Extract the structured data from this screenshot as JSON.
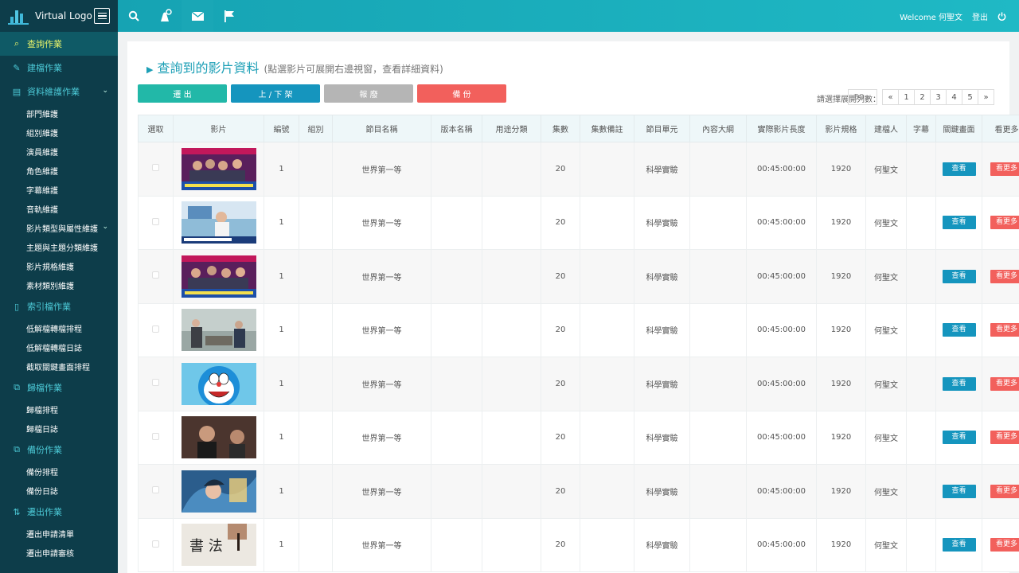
{
  "app": {
    "logo_text": "Virtual Logo"
  },
  "topbar": {
    "welcome": "Welcome 何聖文",
    "logout": "登出"
  },
  "sidebar": {
    "sections": [
      {
        "label": "查詢作業",
        "icon": "search-icon",
        "active": true
      },
      {
        "label": "建檔作業",
        "icon": "edit-icon"
      },
      {
        "label": "資料維護作業",
        "icon": "database-icon",
        "items": [
          "部門維護",
          "組別維護",
          "演員維護",
          "角色維護",
          "字幕維護",
          "音軌維護",
          "影片類型與屬性維護",
          "主題與主題分類維護",
          "影片規格維護",
          "素材類別維護"
        ]
      },
      {
        "label": "索引檔作業",
        "icon": "file-icon",
        "items": [
          "低解檔轉檔排程",
          "低解檔轉檔日誌",
          "截取關鍵畫面排程"
        ]
      },
      {
        "label": "歸檔作業",
        "icon": "archive-icon",
        "items": [
          "歸檔排程",
          "歸檔日誌"
        ]
      },
      {
        "label": "備份作業",
        "icon": "copy-icon",
        "items": [
          "備份排程",
          "備份日誌"
        ]
      },
      {
        "label": "遷出作業",
        "icon": "transfer-icon",
        "items": [
          "遷出申請清單",
          "遷出申請審核"
        ]
      }
    ]
  },
  "page": {
    "title": "查詢到的影片資料",
    "subtitle": "(點選影片可展開右邊視窗，查看詳細資料)",
    "buttons": {
      "out": "遷 出",
      "shelf": "上 / 下 架",
      "scrap": "報 廢",
      "backup": "備 份"
    },
    "pager_label": "請選擇展開列數：",
    "page_size": "50",
    "pages": [
      "«",
      "1",
      "2",
      "3",
      "4",
      "5",
      "»"
    ]
  },
  "table": {
    "headers": [
      "選取",
      "影片",
      "編號",
      "組別",
      "節目名稱",
      "版本名稱",
      "用途分類",
      "集數",
      "集數備註",
      "節目單元",
      "內容大綱",
      "實際影片長度",
      "影片規格",
      "建檔人",
      "字幕",
      "關鍵畫面",
      "看更多"
    ],
    "view_label": "查看",
    "more_label": "看更多",
    "rows": [
      {
        "id": "1",
        "program": "世界第一等",
        "episodes": "20",
        "unit": "科學實驗",
        "duration": "00:45:00:00",
        "spec": "1920",
        "creator": "何聖文"
      },
      {
        "id": "1",
        "program": "世界第一等",
        "episodes": "20",
        "unit": "科學實驗",
        "duration": "00:45:00:00",
        "spec": "1920",
        "creator": "何聖文"
      },
      {
        "id": "1",
        "program": "世界第一等",
        "episodes": "20",
        "unit": "科學實驗",
        "duration": "00:45:00:00",
        "spec": "1920",
        "creator": "何聖文"
      },
      {
        "id": "1",
        "program": "世界第一等",
        "episodes": "20",
        "unit": "科學實驗",
        "duration": "00:45:00:00",
        "spec": "1920",
        "creator": "何聖文"
      },
      {
        "id": "1",
        "program": "世界第一等",
        "episodes": "20",
        "unit": "科學實驗",
        "duration": "00:45:00:00",
        "spec": "1920",
        "creator": "何聖文"
      },
      {
        "id": "1",
        "program": "世界第一等",
        "episodes": "20",
        "unit": "科學實驗",
        "duration": "00:45:00:00",
        "spec": "1920",
        "creator": "何聖文"
      },
      {
        "id": "1",
        "program": "世界第一等",
        "episodes": "20",
        "unit": "科學實驗",
        "duration": "00:45:00:00",
        "spec": "1920",
        "creator": "何聖文"
      },
      {
        "id": "1",
        "program": "世界第一等",
        "episodes": "20",
        "unit": "科學實驗",
        "duration": "00:45:00:00",
        "spec": "1920",
        "creator": "何聖文"
      }
    ]
  },
  "colors": {
    "accent": "#1fb9c5",
    "sidebar": "#0d3d4a",
    "active_item": "#e8f36a",
    "primary_button": "#1595be",
    "danger_button": "#f2605c"
  }
}
